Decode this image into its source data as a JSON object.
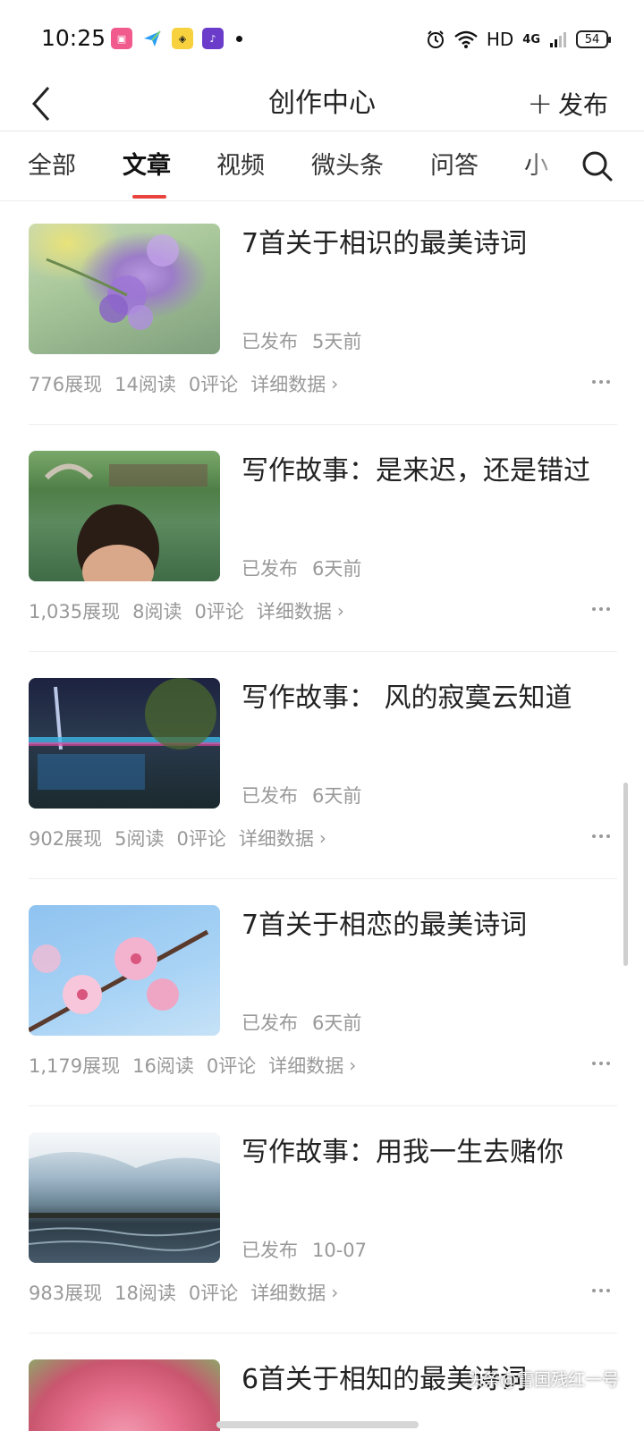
{
  "status_bar": {
    "time": "10:25",
    "network": "HD",
    "network_type": "4G",
    "battery": "54",
    "icons": [
      "bilibili-icon",
      "send-icon",
      "game-app-icon",
      "tiktok-icon",
      "notification-dot",
      "alarm-icon",
      "wifi-icon",
      "signal-icon",
      "battery-icon"
    ]
  },
  "header": {
    "title": "创作中心",
    "publish_label": "发布"
  },
  "tabs": [
    {
      "label": "全部",
      "active": false
    },
    {
      "label": "文章",
      "active": true
    },
    {
      "label": "视频",
      "active": false
    },
    {
      "label": "微头条",
      "active": false
    },
    {
      "label": "问答",
      "active": false
    },
    {
      "label": "小",
      "active": false
    }
  ],
  "articles": [
    {
      "title": "7首关于相识的最美诗词",
      "status": "已发布",
      "time": "5天前",
      "impressions": "776展现",
      "reads": "14阅读",
      "comments": "0评论",
      "detail_label": "详细数据"
    },
    {
      "title": "写作故事：是来迟，还是错过",
      "status": "已发布",
      "time": "6天前",
      "impressions": "1,035展现",
      "reads": "8阅读",
      "comments": "0评论",
      "detail_label": "详细数据"
    },
    {
      "title": "写作故事： 风的寂寞云知道",
      "status": "已发布",
      "time": "6天前",
      "impressions": "902展现",
      "reads": "5阅读",
      "comments": "0评论",
      "detail_label": "详细数据"
    },
    {
      "title": "7首关于相恋的最美诗词",
      "status": "已发布",
      "time": "6天前",
      "impressions": "1,179展现",
      "reads": "16阅读",
      "comments": "0评论",
      "detail_label": "详细数据"
    },
    {
      "title": "写作故事：用我一生去赌你",
      "status": "已发布",
      "time": "10-07",
      "impressions": "983展现",
      "reads": "18阅读",
      "comments": "0评论",
      "detail_label": "详细数据"
    },
    {
      "title": "6首关于相知的最美诗词"
    }
  ],
  "watermark": "头条@雪国残红一号",
  "colors": {
    "accent": "#e8433d",
    "text_primary": "#222222",
    "text_secondary": "#999999",
    "divider": "#efefef"
  }
}
